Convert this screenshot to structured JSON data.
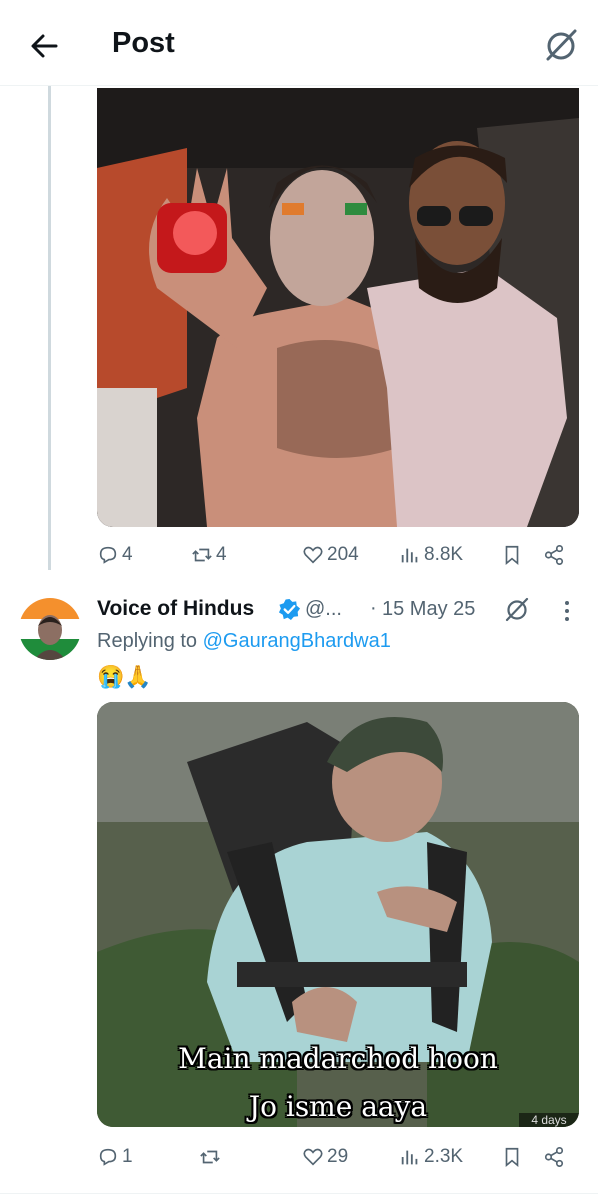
{
  "header": {
    "title": "Post"
  },
  "tweet1": {
    "replies": "4",
    "retweets": "4",
    "likes": "204",
    "views": "8.8K"
  },
  "tweet2": {
    "author_name": "Voice of Hindus",
    "handle": "@...",
    "separator": "·",
    "date": "15 May 25",
    "reply_prefix": "Replying to ",
    "reply_to": "@GaurangBhardwa1",
    "emoji_text": "😭🙏",
    "caption_line1": "Main madarchod hoon",
    "caption_line2": "Jo isme aaya",
    "video_timestamp": "4 days",
    "replies": "1",
    "retweets": "",
    "likes": "29",
    "views": "2.3K"
  },
  "colors": {
    "accent": "#1d9bf0",
    "muted": "#536471",
    "thread_line": "#cfd9de"
  },
  "icons": [
    "back-arrow-icon",
    "grok-icon",
    "reply-icon",
    "retweet-icon",
    "like-icon",
    "views-icon",
    "bookmark-icon",
    "share-icon",
    "verified-icon",
    "more-icon"
  ]
}
